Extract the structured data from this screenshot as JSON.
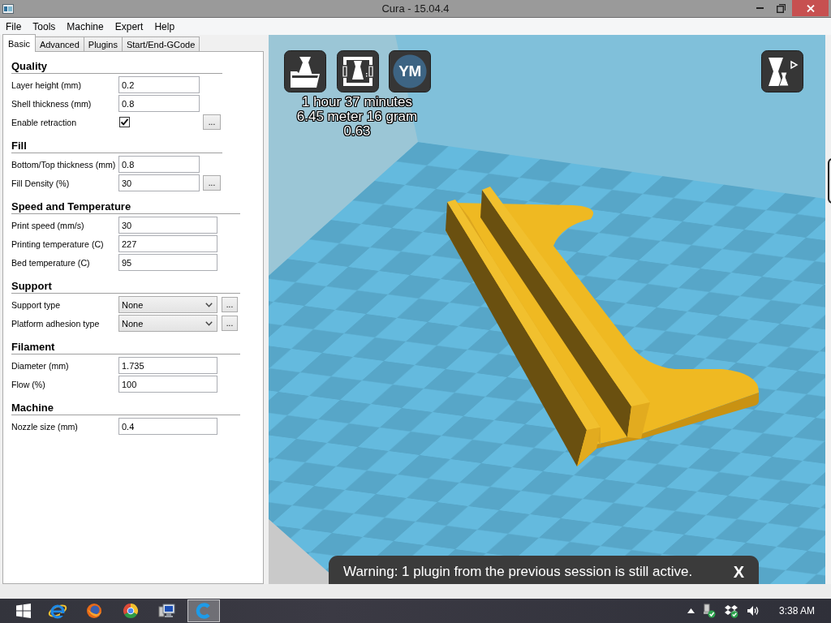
{
  "window": {
    "title": "Cura - 15.04.4"
  },
  "menu": [
    "File",
    "Tools",
    "Machine",
    "Expert",
    "Help"
  ],
  "tabs": [
    {
      "label": "Basic",
      "selected": true
    },
    {
      "label": "Advanced",
      "selected": false
    },
    {
      "label": "Plugins",
      "selected": false
    },
    {
      "label": "Start/End-GCode",
      "selected": false
    }
  ],
  "sections": [
    {
      "title": "Quality",
      "rows": [
        {
          "kind": "text",
          "label": "Layer height (mm)",
          "value": "0.2"
        },
        {
          "kind": "text",
          "label": "Shell thickness (mm)",
          "value": "0.8"
        },
        {
          "kind": "checkbox",
          "label": "Enable retraction",
          "checked": true,
          "button": "..."
        }
      ]
    },
    {
      "title": "Fill",
      "rows": [
        {
          "kind": "text",
          "label": "Bottom/Top thickness (mm)",
          "value": "0.8"
        },
        {
          "kind": "text",
          "label": "Fill Density (%)",
          "value": "30",
          "button": "..."
        }
      ]
    },
    {
      "title": "Speed and Temperature",
      "rows": [
        {
          "kind": "text",
          "label": "Print speed (mm/s)",
          "value": "30"
        },
        {
          "kind": "text",
          "label": "Printing temperature (C)",
          "value": "227"
        },
        {
          "kind": "text",
          "label": "Bed temperature (C)",
          "value": "95"
        }
      ]
    },
    {
      "title": "Support",
      "rows": [
        {
          "kind": "dropdown",
          "label": "Support type",
          "value": "None",
          "button": "..."
        },
        {
          "kind": "dropdown",
          "label": "Platform adhesion type",
          "value": "None",
          "button": "..."
        }
      ]
    },
    {
      "title": "Filament",
      "rows": [
        {
          "kind": "text",
          "label": "Diameter (mm)",
          "value": "1.735"
        },
        {
          "kind": "text",
          "label": "Flow (%)",
          "value": "100"
        }
      ]
    },
    {
      "title": "Machine",
      "rows": [
        {
          "kind": "text",
          "label": "Nozzle size (mm)",
          "value": "0.4"
        }
      ]
    }
  ],
  "viewport": {
    "badge": "YM",
    "stats": [
      "1 hour 37 minutes",
      "6.45 meter 16 gram",
      "0.63"
    ]
  },
  "notification": {
    "message": "Warning: 1 plugin from the previous session is still active.",
    "close": "X"
  },
  "taskbar": {
    "apps": [
      {
        "kind": "ebrowser",
        "selected": false
      },
      {
        "kind": "fox",
        "selected": false
      },
      {
        "kind": "ring",
        "selected": false
      },
      {
        "kind": "monitor",
        "selected": false
      },
      {
        "kind": "slicer",
        "selected": true
      }
    ],
    "clock": "3:38 AM"
  }
}
